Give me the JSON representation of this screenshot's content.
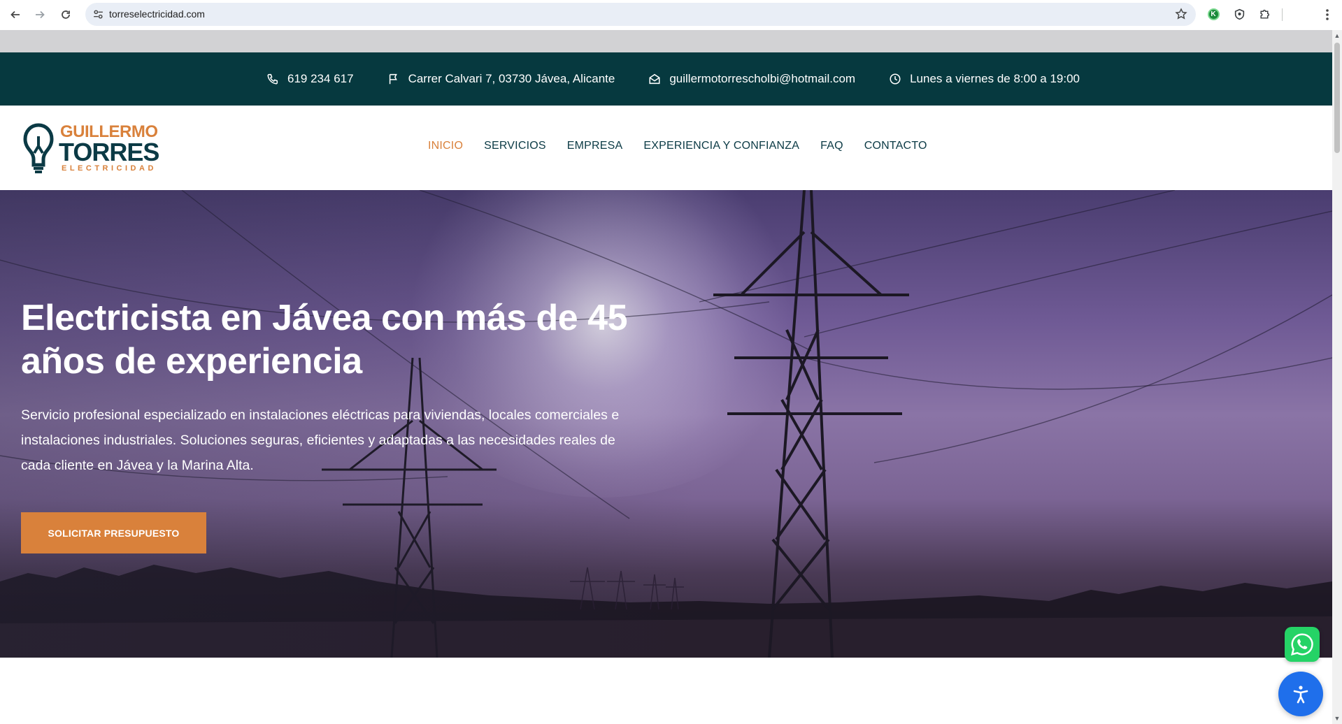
{
  "browser": {
    "url": "torreselectricidad.com"
  },
  "topbar": {
    "phone": "619 234 617",
    "address": "Carrer Calvari 7, 03730 Jávea, Alicante",
    "email": "guillermotorrescholbi@hotmail.com",
    "hours": "Lunes a viernes de 8:00 a 19:00"
  },
  "logo": {
    "line1": "GUILLERMO",
    "line2": "TORRES",
    "line3": "ELECTRICIDAD"
  },
  "menu": {
    "items": [
      {
        "label": "INICIO",
        "active": true
      },
      {
        "label": "SERVICIOS"
      },
      {
        "label": "EMPRESA"
      },
      {
        "label": "EXPERIENCIA Y CONFIANZA"
      },
      {
        "label": "FAQ"
      },
      {
        "label": "CONTACTO"
      }
    ]
  },
  "hero": {
    "title": "Electricista en Jávea con más de 45 años de experiencia",
    "description": "Servicio profesional especializado en instalaciones eléctricas para viviendas, locales comerciales e instalaciones industriales. Soluciones seguras, eficientes y adaptadas a las necesidades reales de cada cliente en Jávea y la Marina Alta.",
    "cta_label": "SOLICITAR PRESUPUESTO"
  },
  "colors": {
    "topbar_bg": "#06393f",
    "brand_dark": "#0b3a45",
    "accent": "#d9813b",
    "whatsapp": "#25d366",
    "accessibility": "#1f6feb"
  }
}
